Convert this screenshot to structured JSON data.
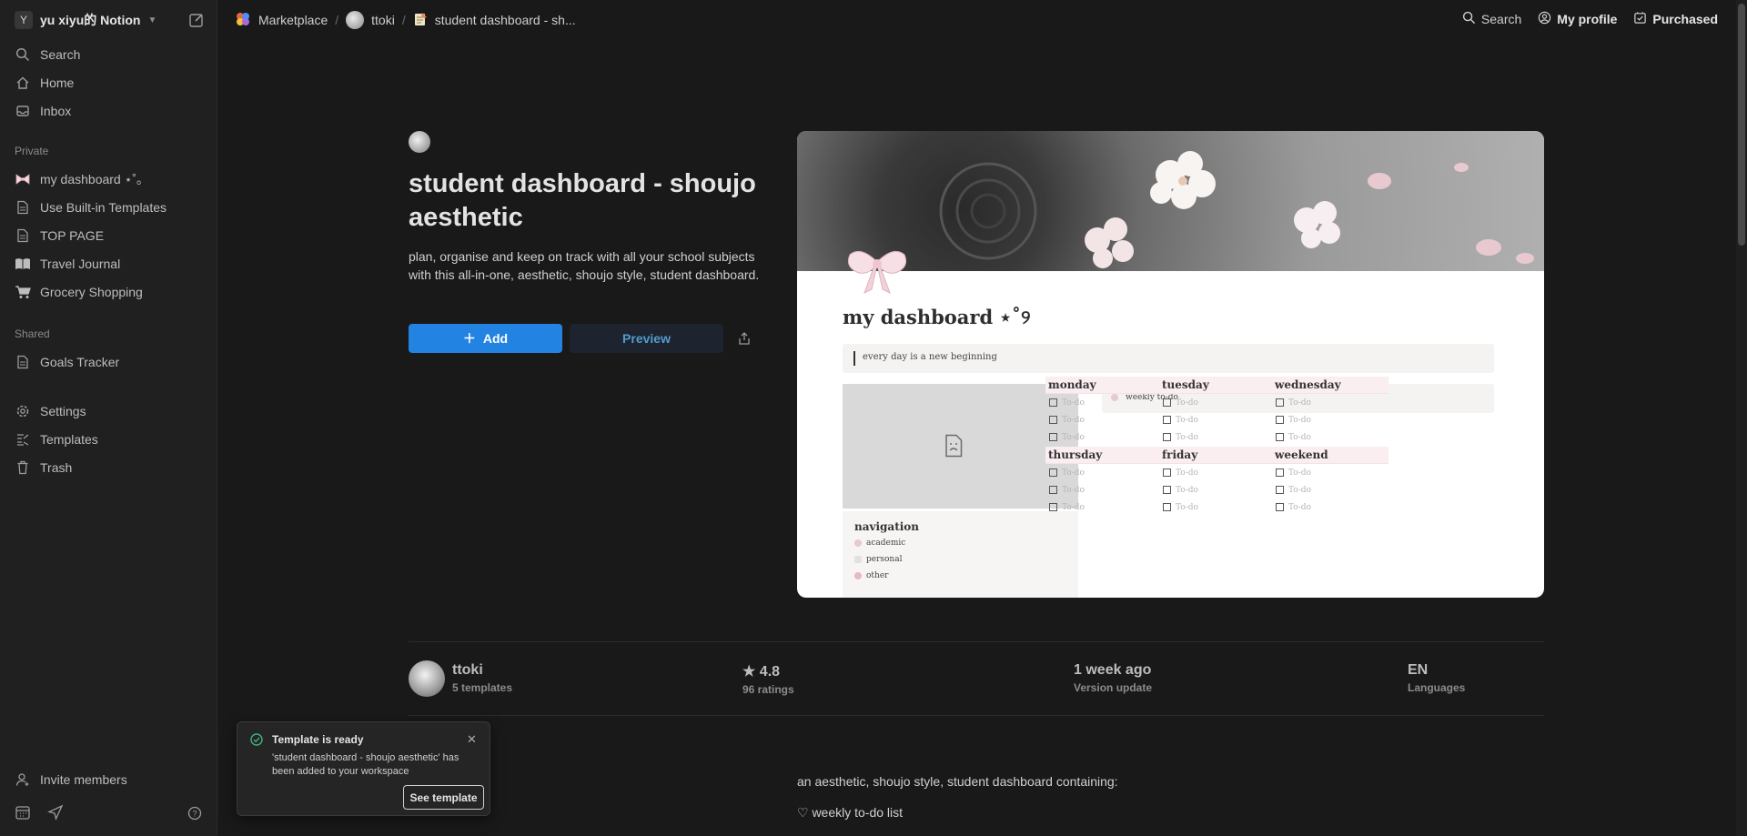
{
  "workspace": {
    "avatar_letter": "Y",
    "name": "yu xiyu的 Notion"
  },
  "sidebar": {
    "top_items": [
      {
        "label": "Search",
        "icon": "search-icon"
      },
      {
        "label": "Home",
        "icon": "home-icon"
      },
      {
        "label": "Inbox",
        "icon": "inbox-icon"
      }
    ],
    "private_label": "Private",
    "private_items": [
      {
        "label": "my dashboard ⋆˚｡",
        "icon": "bow-icon"
      },
      {
        "label": "Use Built-in Templates",
        "icon": "page-icon"
      },
      {
        "label": "TOP PAGE",
        "icon": "page-icon"
      },
      {
        "label": "Travel Journal",
        "icon": "book-icon"
      },
      {
        "label": "Grocery Shopping",
        "icon": "cart-icon"
      }
    ],
    "shared_label": "Shared",
    "shared_items": [
      {
        "label": "Goals Tracker",
        "icon": "page-icon"
      }
    ],
    "utility_items": [
      {
        "label": "Settings",
        "icon": "gear-icon"
      },
      {
        "label": "Templates",
        "icon": "templates-icon"
      },
      {
        "label": "Trash",
        "icon": "trash-icon"
      }
    ],
    "invite_label": "Invite members"
  },
  "breadcrumb": [
    {
      "label": "Marketplace"
    },
    {
      "label": "ttoki"
    },
    {
      "label": "student dashboard - sh..."
    }
  ],
  "topbar": {
    "search": "Search",
    "profile": "My profile",
    "purchased": "Purchased"
  },
  "template": {
    "title": "student dashboard - shoujo aesthetic",
    "description": "plan, organise and keep on track with all your school subjects with this all-in-one, aesthetic, shoujo style, student dashboard.",
    "add_label": "Add",
    "preview_label": "Preview"
  },
  "preview": {
    "title": "my dashboard ⋆˚୨",
    "quote": "every day is a new beginning",
    "weekly": "weekly to-do",
    "navigation": {
      "heading": "navigation",
      "items": [
        "academic",
        "personal",
        "other"
      ]
    },
    "todo_label": "To-do",
    "days": [
      "monday",
      "tuesday",
      "wednesday",
      "thursday",
      "friday",
      "weekend"
    ]
  },
  "stats": {
    "creator": {
      "name": "ttoki",
      "sub": "5 templates"
    },
    "rating": {
      "value": "★ 4.8",
      "sub": "96 ratings"
    },
    "updated": {
      "value": "1 week ago",
      "sub": "Version update"
    },
    "language": {
      "value": "EN",
      "sub": "Languages"
    }
  },
  "body": {
    "line1": "an aesthetic, shoujo style, student dashboard containing:",
    "line2": "♡ weekly to-do list"
  },
  "toast": {
    "title": "Template is ready",
    "message": "'student dashboard - shoujo aesthetic' has been added to your workspace",
    "action": "See template",
    "close": "✕"
  }
}
